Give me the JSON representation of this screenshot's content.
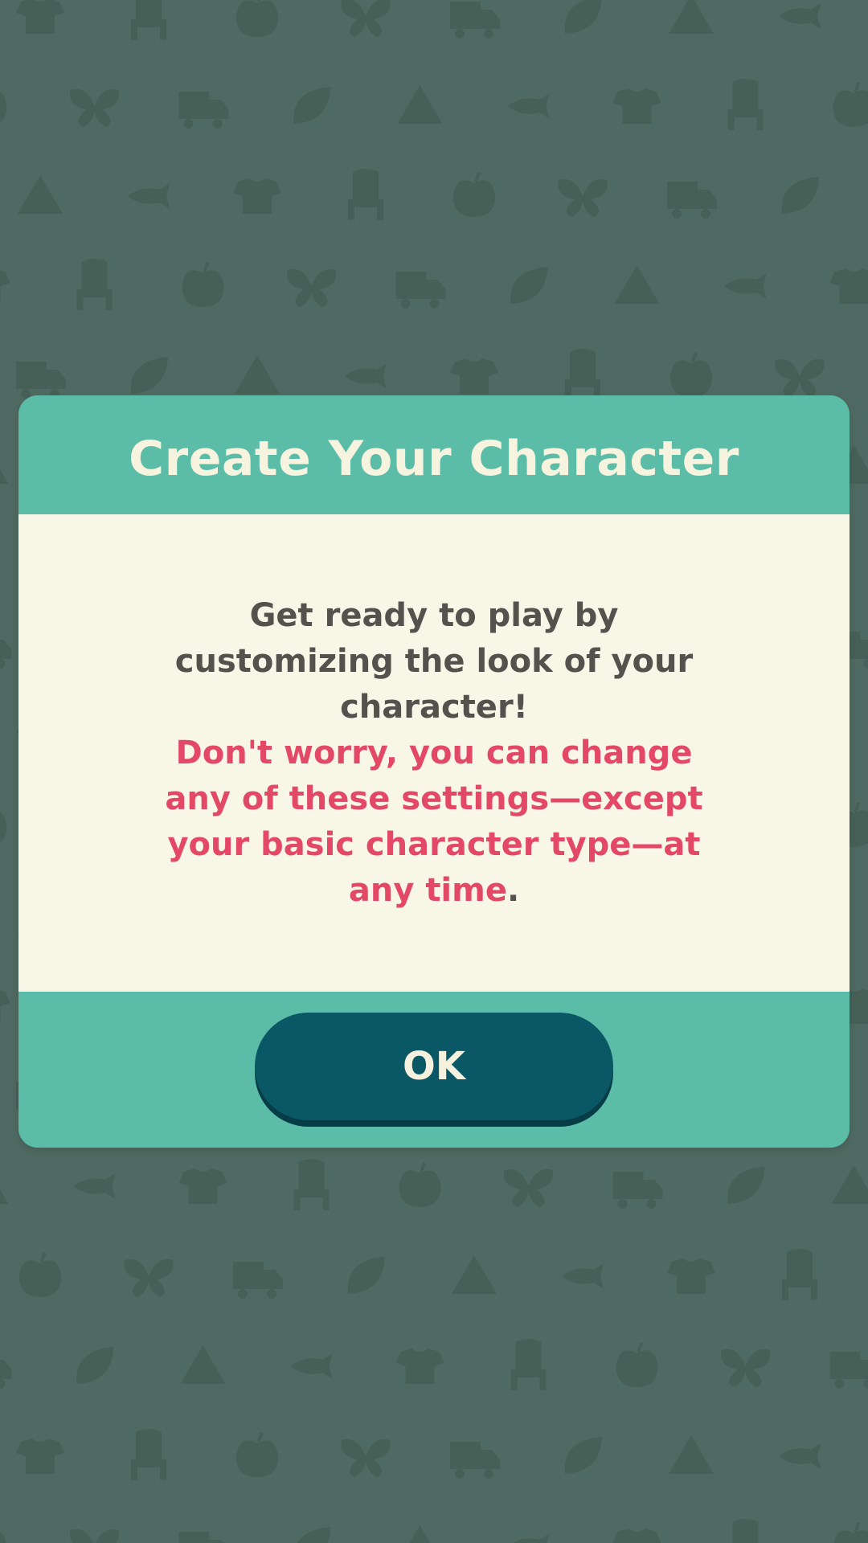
{
  "dialog": {
    "title": "Create Your Character",
    "message_line1": "Get ready to play by customizing the look of your character!",
    "message_warning": "Don't worry, you can change any of these settings—except your basic character type—at any time",
    "message_period": ".",
    "ok_label": "OK"
  },
  "colors": {
    "background": "#4f6a62",
    "pattern": "#466058",
    "dialog_teal": "#5bbda8",
    "body_cream": "#f8f6e7",
    "title_text": "#f6f3df",
    "body_text": "#55524e",
    "warning_text": "#e34867",
    "button_bg": "#0a5866"
  },
  "icons": {
    "background_pattern": [
      "fish-icon",
      "shirt-icon",
      "chair-icon",
      "apple-icon",
      "butterfly-icon",
      "truck-icon",
      "leaf-icon",
      "tent-icon"
    ]
  }
}
